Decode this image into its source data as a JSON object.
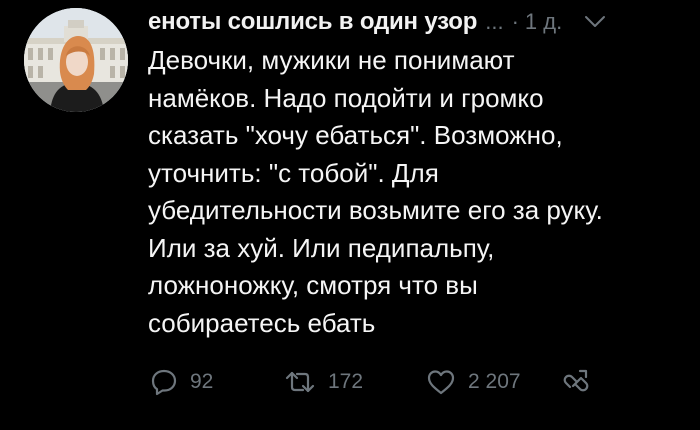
{
  "author": {
    "display_name": "еноты сошлись в один узор",
    "ellipsis": "...",
    "separator": "·",
    "time": "1 д."
  },
  "tweet": {
    "lines": [
      "Девочки, мужики не понимают",
      "намёков. Надо подойти и громко",
      "сказать \"хочу ебаться\". Возможно,",
      "уточнить: \"с тобой\". Для",
      "убедительности возьмите его за руку.",
      "Или за хуй. Или педипальпу,",
      "ложноножку, смотря что вы",
      "собираетесь ебать"
    ]
  },
  "actions": {
    "replies": "92",
    "retweets": "172",
    "likes": "2 207"
  },
  "icons": {
    "reply": "reply-icon",
    "retweet": "retweet-icon",
    "like": "heart-icon",
    "share": "share-icon",
    "menu": "chevron-down-icon"
  },
  "colors": {
    "background": "#000000",
    "text": "#f5f5f5",
    "muted": "#6e767d"
  }
}
